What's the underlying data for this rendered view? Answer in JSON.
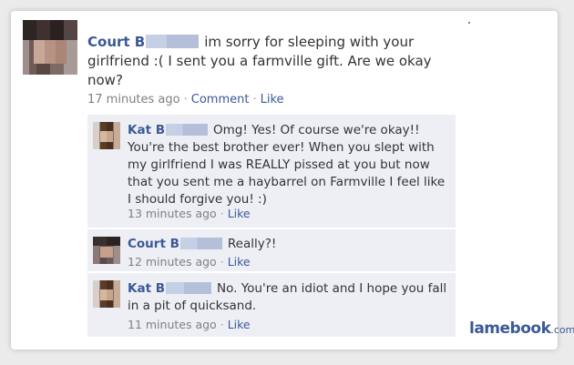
{
  "post": {
    "author": "Court B",
    "text": "im sorry for sleeping with your girlfriend :( I sent you a farmville gift. Are we okay now?",
    "time": "17 minutes ago",
    "comment_link": "Comment",
    "like_link": "Like",
    "separator": "·"
  },
  "comments": [
    {
      "author": "Kat B",
      "text": "Omg! Yes! Of course we're okay!! You're the best brother ever! When you slept with my girlfriend I was REALLY pissed at you but now that you sent me a haybarrel on Farmville I feel like I should forgive you! :)",
      "time": "13 minutes ago",
      "like_link": "Like"
    },
    {
      "author": "Court B",
      "text": "Really?!",
      "time": "12 minutes ago",
      "like_link": "Like"
    },
    {
      "author": "Kat B",
      "text": "No. You're an idiot and I hope you fall in a pit of quicksand.",
      "time": "11 minutes ago",
      "like_link": "Like"
    }
  ],
  "watermark": {
    "main": "lamebook",
    "tld": ".com"
  },
  "colors": {
    "name_link": "#3b5998",
    "comment_bg": "#edeff4",
    "meta_text": "#808080"
  }
}
